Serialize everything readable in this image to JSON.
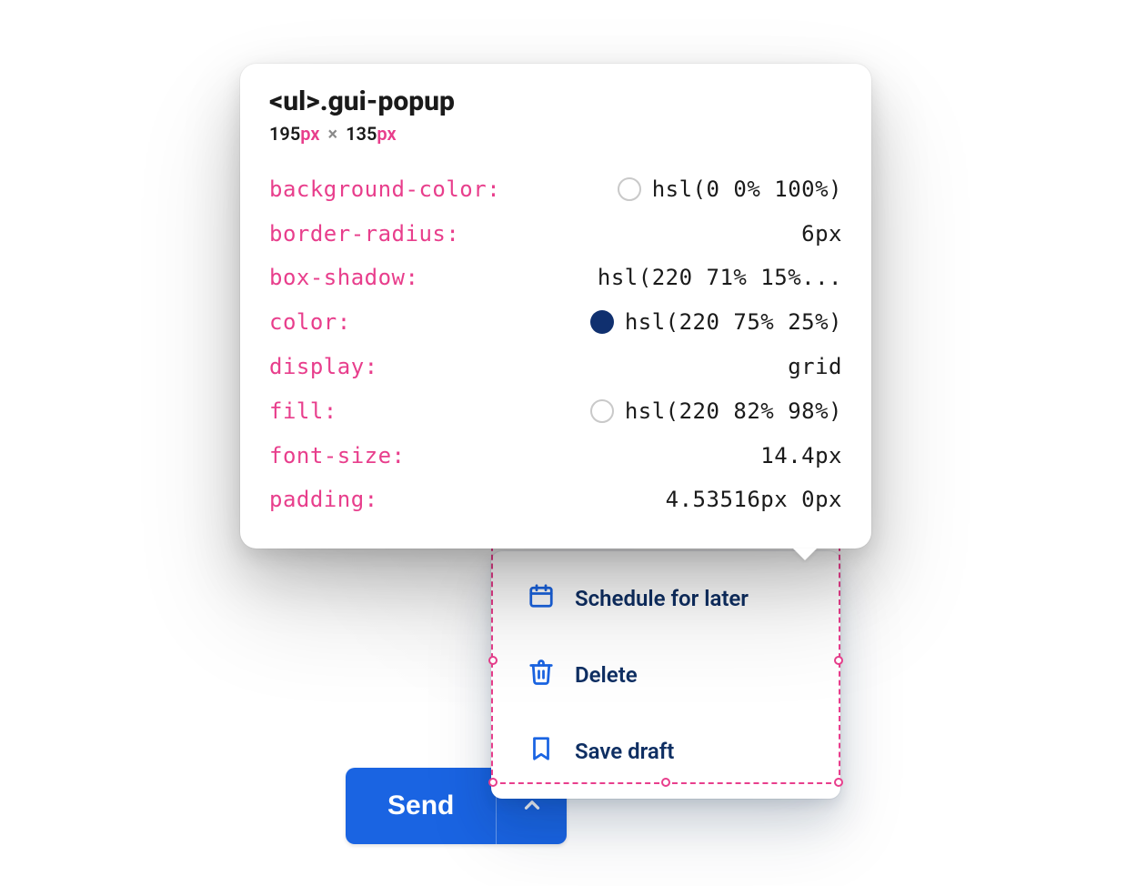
{
  "send_button": {
    "label": "Send"
  },
  "popup": {
    "items": [
      {
        "icon": "calendar-icon",
        "label": "Schedule for later"
      },
      {
        "icon": "trash-icon",
        "label": "Delete"
      },
      {
        "icon": "bookmark-icon",
        "label": "Save draft"
      }
    ]
  },
  "inspector": {
    "element_tag": "<ul>",
    "element_class": ".gui-popup",
    "dims": {
      "w": "195",
      "w_unit": "px",
      "sep": "×",
      "h": "135",
      "h_unit": "px"
    },
    "props": [
      {
        "name": "background-color",
        "value": "hsl(0 0% 100%)",
        "swatch": "#ffffff"
      },
      {
        "name": "border-radius",
        "value": "6px"
      },
      {
        "name": "box-shadow",
        "value": "hsl(220 71% 15%..."
      },
      {
        "name": "color",
        "value": "hsl(220 75% 25%)",
        "swatch": "#10306f",
        "filled": true
      },
      {
        "name": "display",
        "value": "grid"
      },
      {
        "name": "fill",
        "value": "hsl(220 82% 98%)",
        "swatch": "#f6f9fe"
      },
      {
        "name": "font-size",
        "value": "14.4px"
      },
      {
        "name": "padding",
        "value": "4.53516px 0px"
      }
    ]
  }
}
